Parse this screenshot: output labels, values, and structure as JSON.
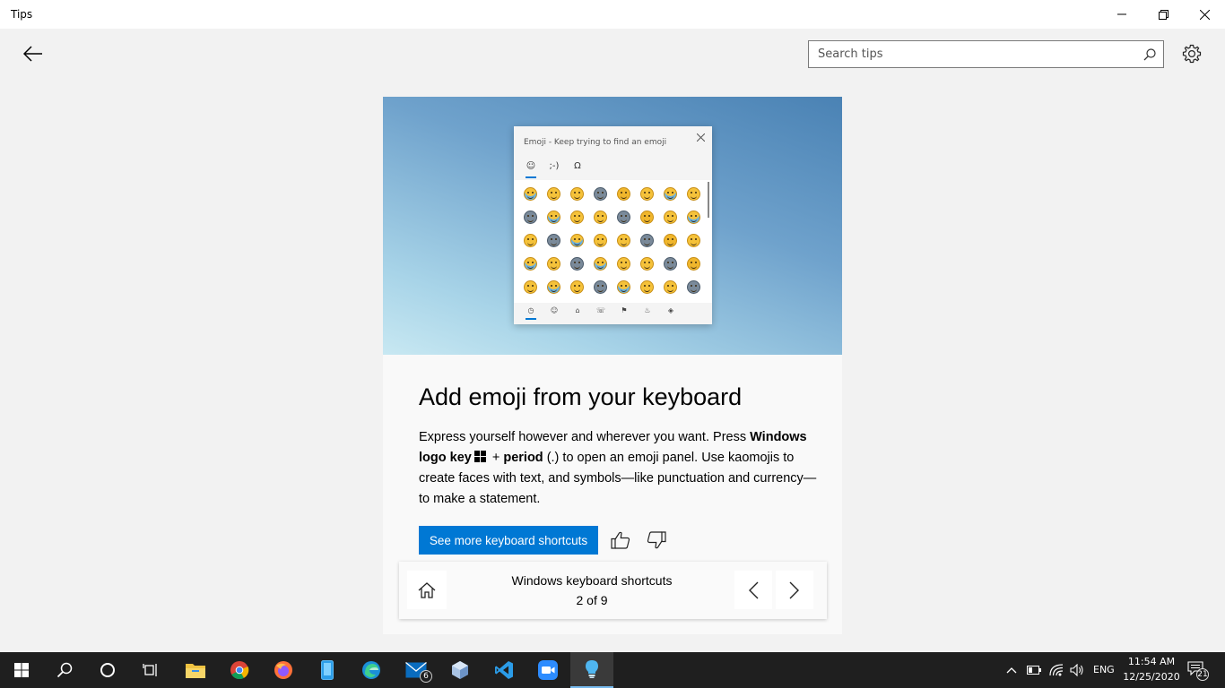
{
  "window": {
    "title": "Tips",
    "minimize_icon": "minimize-icon",
    "restore_icon": "restore-icon",
    "close_icon": "close-icon"
  },
  "header": {
    "back_icon": "arrow-left-icon",
    "search_placeholder": "Search tips",
    "settings_icon": "gear-icon"
  },
  "hero": {
    "panel_title": "Emoji - Keep trying to find an emoji",
    "tabs": [
      "☺",
      ";-)",
      "Ω"
    ],
    "categories": [
      "◷",
      "☺",
      "⌂",
      "☏",
      "⚑",
      "♨",
      "◈"
    ]
  },
  "tip": {
    "title": "Add emoji from your keyboard",
    "body_part1": "Express yourself however and wherever you want. Press ",
    "body_bold1": "Windows logo key",
    "body_plus": " + ",
    "body_bold2": "period",
    "body_part2": " (.) to open an emoji panel. Use kaomojis to create faces with text, and symbols—like punctuation and currency—to make a statement.",
    "cta_label": "See more keyboard shortcuts",
    "like_icon": "thumbs-up-icon",
    "dislike_icon": "thumbs-down-icon"
  },
  "collection_nav": {
    "collection_name": "Windows keyboard shortcuts",
    "position": "2 of 9",
    "home_icon": "home-icon",
    "prev_icon": "chevron-left-icon",
    "next_icon": "chevron-right-icon"
  },
  "taskbar": {
    "mail_badge": "6",
    "language": "ENG",
    "time": "11:54 AM",
    "date": "12/25/2020",
    "notification_count": "21"
  },
  "colors": {
    "accent": "#0078d4",
    "taskbar": "#1f1f1f"
  }
}
